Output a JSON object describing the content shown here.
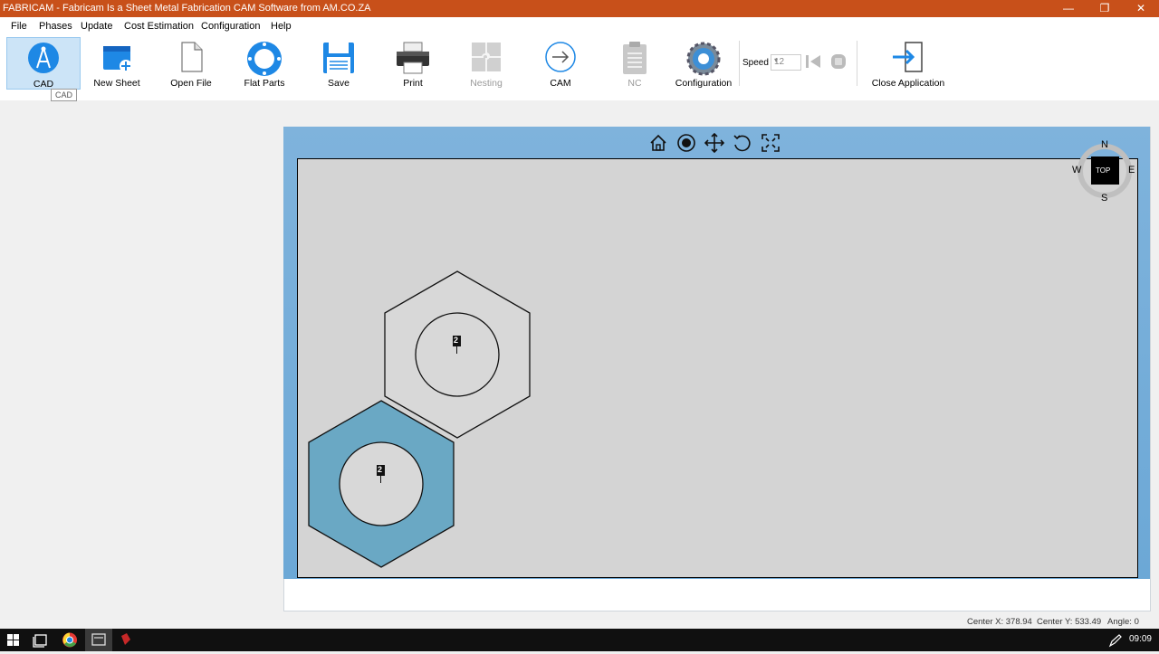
{
  "window": {
    "title": "FABRICAM - Fabricam Is a Sheet Metal Fabrication CAM Software from AM.CO.ZA",
    "controls": {
      "minimize": "—",
      "restore": "❐",
      "close": "✕"
    }
  },
  "menu": [
    "File",
    "Phases",
    "Update",
    "Cost Estimation",
    "Configuration",
    "Help"
  ],
  "toolbar": {
    "cad": "CAD",
    "new_sheet": "New Sheet",
    "open_file": "Open File",
    "flat_parts": "Flat Parts",
    "save": "Save",
    "print": "Print",
    "nesting": "Nesting",
    "cam": "CAM",
    "nc": "NC",
    "configuration": "Configuration",
    "speed_label": "Speed",
    "speed_value": "12",
    "close_application": "Close Application",
    "tooltip": "CAD"
  },
  "viewport": {
    "compass": {
      "n": "N",
      "s": "S",
      "e": "E",
      "w": "W",
      "view": "TOP"
    },
    "parts": [
      {
        "label": "2",
        "selected": false
      },
      {
        "label": "2",
        "selected": true
      }
    ],
    "colors": {
      "selected_fill": "#6aa8c4",
      "canvas": "#d4d4d4",
      "header": "#6ca8d6"
    }
  },
  "status": {
    "center_x": "Center X: 378.94",
    "center_y": "Center Y: 533.49",
    "angle": "Angle: 0"
  },
  "taskbar": {
    "clock": "09:09"
  }
}
